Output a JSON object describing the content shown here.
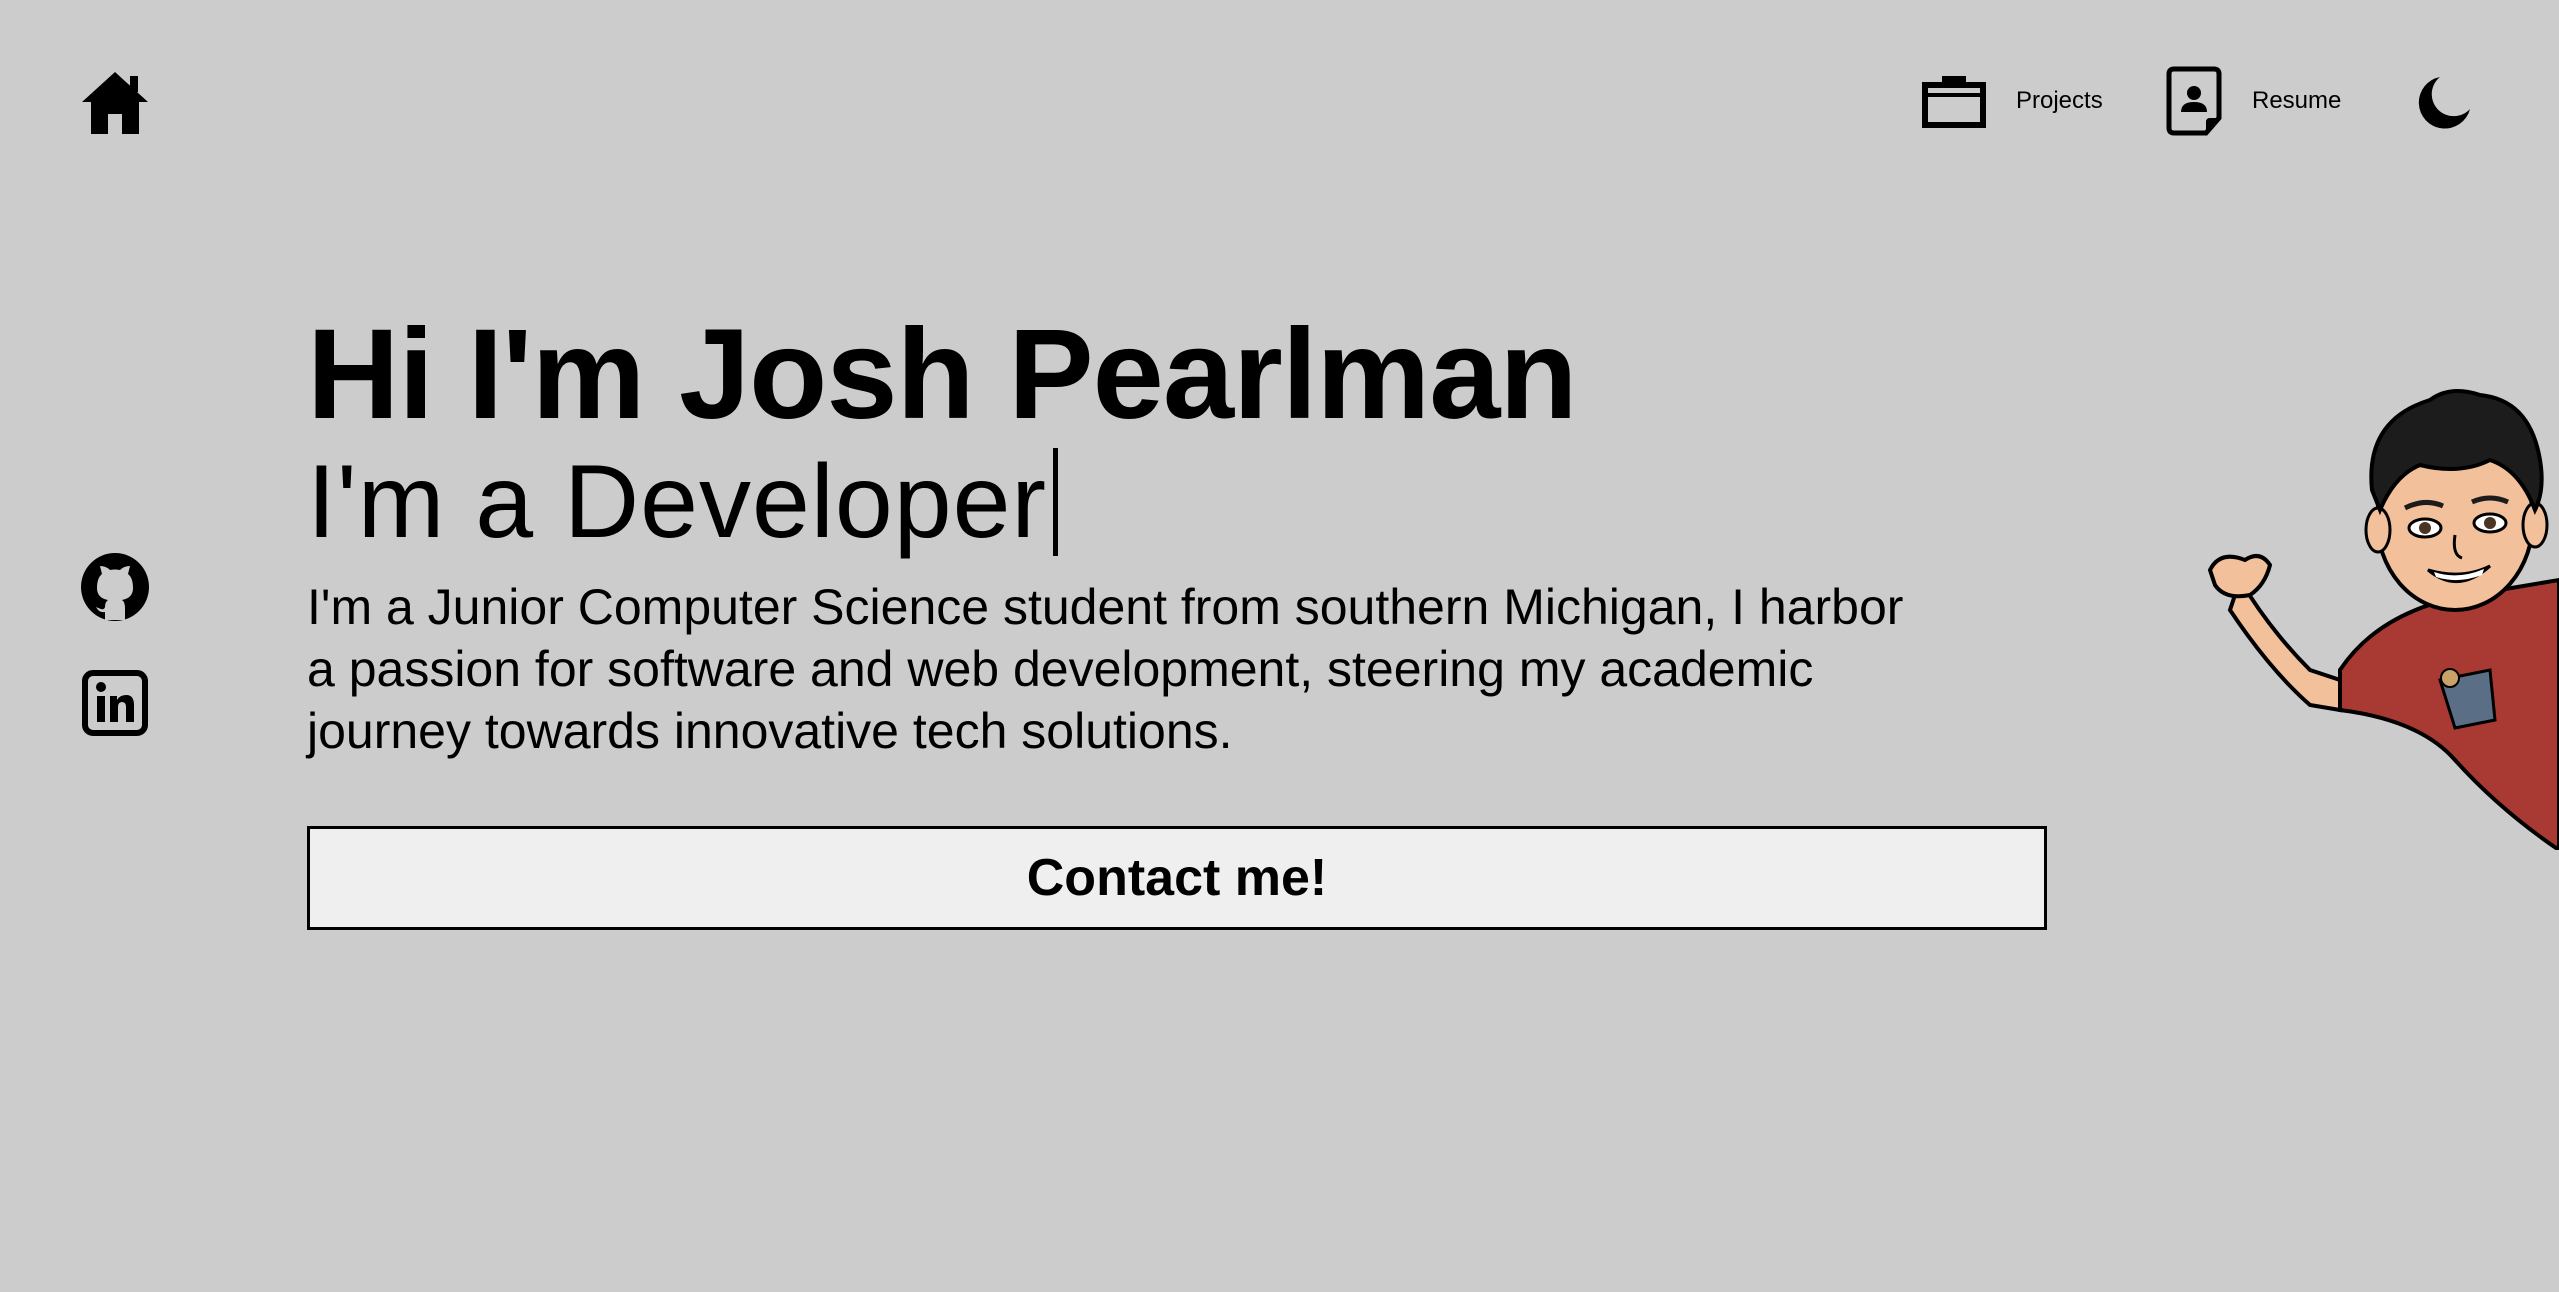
{
  "nav": {
    "home_icon": "home-icon",
    "items": [
      {
        "label": "Projects",
        "icon": "briefcase-icon"
      },
      {
        "label": "Resume",
        "icon": "resume-icon"
      }
    ],
    "theme_toggle_icon": "moon-icon"
  },
  "social": {
    "github_icon": "github-icon",
    "linkedin_icon": "linkedin-icon"
  },
  "hero": {
    "title": "Hi I'm Josh Pearlman",
    "subtitle": "I'm a Developer",
    "bio": "I'm a Junior Computer Science student from southern Michigan, I harbor a passion for software and web development, steering my academic journey towards innovative tech solutions.",
    "contact_label": "Contact me!"
  },
  "avatar": {
    "icon": "waving-avatar-illustration"
  },
  "colors": {
    "background": "#cccccc",
    "text": "#000000",
    "button_bg": "#efefef",
    "shirt": "#a83a33"
  }
}
